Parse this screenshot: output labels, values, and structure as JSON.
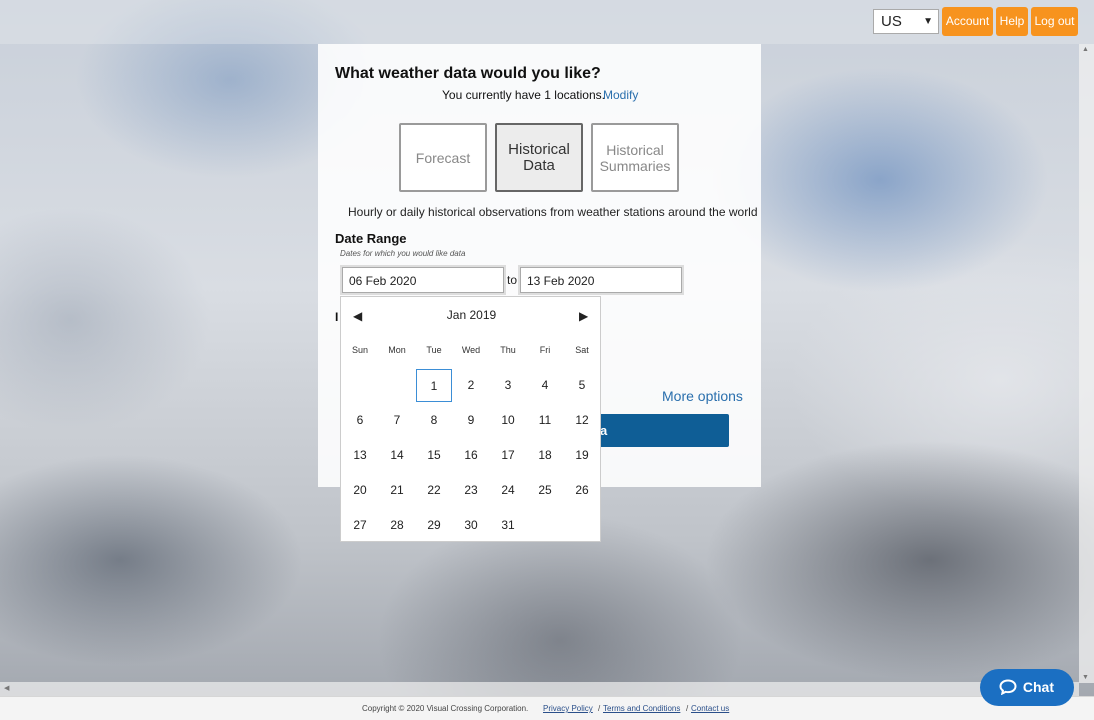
{
  "header": {
    "country": "US",
    "buttons": [
      "Account",
      "Help",
      "Log out"
    ]
  },
  "main": {
    "heading": "What weather data would you like?",
    "locations_text": "You currently have 1 locations.",
    "modify_label": "Modify",
    "data_types": [
      {
        "label": "Forecast",
        "active": false
      },
      {
        "label": "Historical Data",
        "active": true
      },
      {
        "label": "Historical Summaries",
        "active": false
      }
    ],
    "description": "Hourly or daily historical observations from weather stations around the world",
    "date_range": {
      "label": "Date Range",
      "hint": "Dates for which you would like data",
      "start": "06 Feb 2020",
      "to_label": "to",
      "end": "13 Feb 2020"
    },
    "partial_label": "I",
    "more_options": "More options",
    "submit_partial": "a"
  },
  "calendar": {
    "prev_icon": "◀",
    "next_icon": "▶",
    "month_label": "Jan 2019",
    "weekdays": [
      "Sun",
      "Mon",
      "Tue",
      "Wed",
      "Thu",
      "Fri",
      "Sat"
    ],
    "first_weekday_index": 2,
    "days_in_month": 31,
    "selected_day": 1
  },
  "footer": {
    "copyright": "Copyright © 2020 Visual Crossing Corporation.",
    "privacy": "Privacy Policy",
    "sep1": "/",
    "terms": "Terms and Conditions",
    "sep2": "/",
    "contact": "Contact us"
  },
  "chat": {
    "label": "Chat",
    "color": "#1b6fc2"
  },
  "colors": {
    "accent_orange": "#f7931e",
    "primary_blue": "#0f5e96",
    "link_blue": "#2a6fad"
  }
}
